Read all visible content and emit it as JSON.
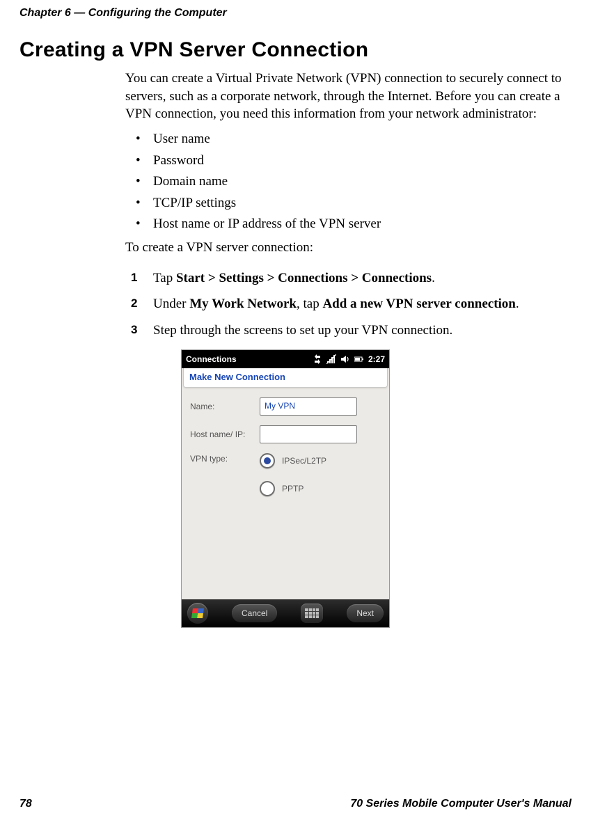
{
  "header": {
    "chapter": "Chapter 6 — Configuring the Computer"
  },
  "title": "Creating a VPN Server Connection",
  "intro": "You can create a Virtual Private Network (VPN) connection to securely connect to servers, such as a corporate network, through the Internet. Before you can create a VPN connection, you need this information from your network administrator:",
  "bullets": [
    "User name",
    "Password",
    "Domain name",
    "TCP/IP settings",
    "Host name or IP address of the VPN server"
  ],
  "lead": "To create a VPN server connection:",
  "steps": {
    "s1": {
      "num": "1",
      "pre": "Tap ",
      "bold": "Start > Settings > Connections > Connections",
      "post": "."
    },
    "s2": {
      "num": "2",
      "pre": "Under ",
      "bold1": "My Work Network",
      "mid": ", tap ",
      "bold2": "Add a new VPN server connection",
      "post": "."
    },
    "s3": {
      "num": "3",
      "text": "Step through the screens to set up your VPN connection."
    }
  },
  "screenshot": {
    "topbar": {
      "title": "Connections",
      "time": "2:27"
    },
    "subtitle": "Make New Connection",
    "form": {
      "name_label": "Name:",
      "name_value": "My VPN",
      "host_label": "Host name/ IP:",
      "host_value": "",
      "type_label": "VPN type:",
      "radio1": "IPSec/L2TP",
      "radio2": "PPTP"
    },
    "bottombar": {
      "cancel": "Cancel",
      "next": "Next"
    }
  },
  "footer": {
    "page": "78",
    "manual": "70 Series Mobile Computer User's Manual"
  }
}
